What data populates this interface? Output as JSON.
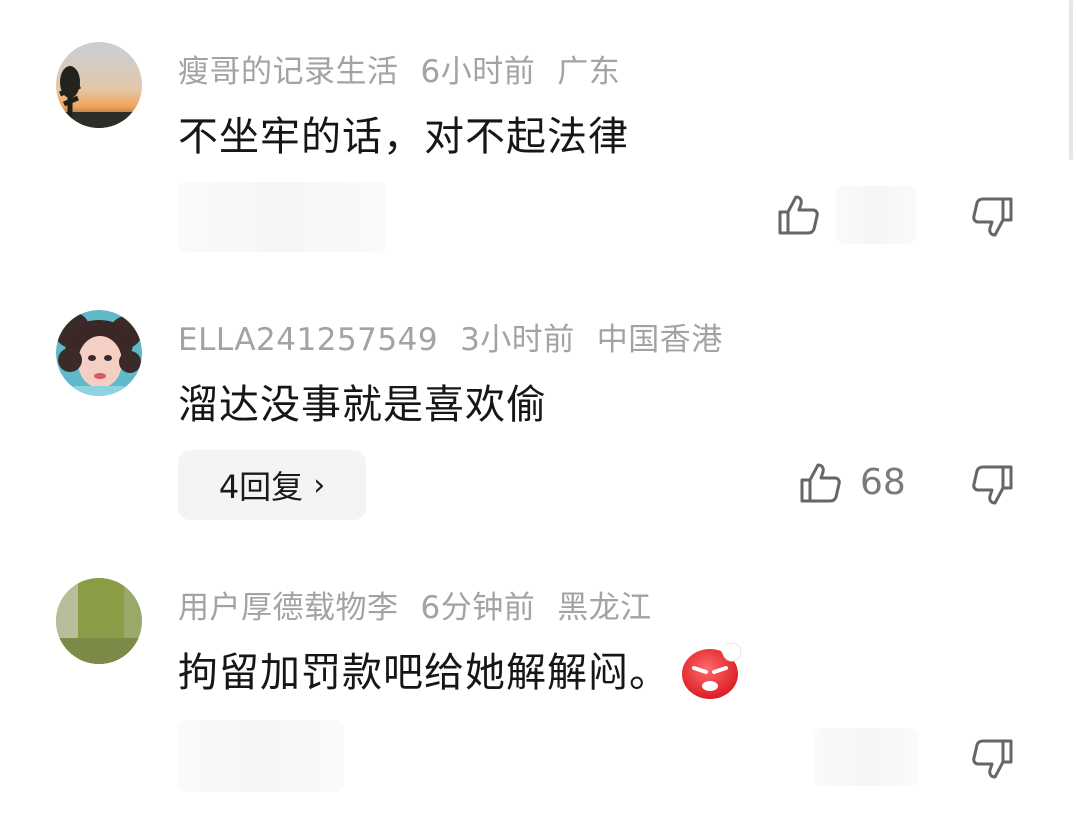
{
  "comments": [
    {
      "username": "瘦哥的记录生活",
      "time": "6小时前",
      "location": "广东",
      "text": "不坐牢的话，对不起法律",
      "likes": "",
      "reply_label": ""
    },
    {
      "username": "ELLA241257549",
      "time": "3小时前",
      "location": "中国香港",
      "text": "溜达没事就是喜欢偷",
      "likes": "68",
      "reply_label": "4回复"
    },
    {
      "username": "用户厚德载物李",
      "time": "6分钟前",
      "location": "黑龙江",
      "text": "拘留加罚款吧给她解解闷。",
      "likes": "",
      "reply_label": ""
    }
  ],
  "icons": {
    "like": "thumb-up-icon",
    "dislike": "thumb-down-icon",
    "chevron": "chevron-right-icon",
    "emoji": "angry-face-emoji"
  },
  "chevron_glyph": "›",
  "colors": {
    "meta_text": "#a3a3a3",
    "body_text": "#161616",
    "pill_bg": "#f4f4f4",
    "icon_stroke": "#666666",
    "emoji_red": "#e8222c"
  }
}
